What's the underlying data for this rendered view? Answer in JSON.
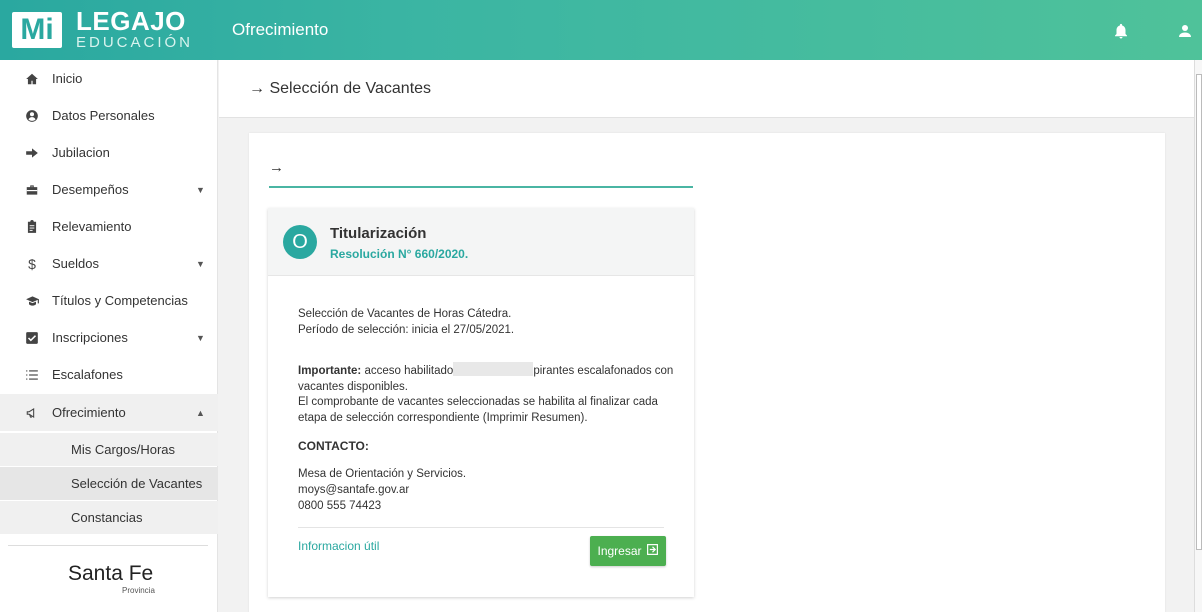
{
  "header": {
    "logo_mi": "Mi",
    "logo_legajo": "LEGAJO",
    "logo_edu": "EDUCACIÓN",
    "title": "Ofrecimiento"
  },
  "sidebar": {
    "items": [
      {
        "label": "Inicio",
        "icon": "home-icon"
      },
      {
        "label": "Datos Personales",
        "icon": "user-circle-icon"
      },
      {
        "label": "Jubilacion",
        "icon": "arrow-right-icon"
      },
      {
        "label": "Desempeños",
        "icon": "briefcase-icon"
      },
      {
        "label": "Relevamiento",
        "icon": "clipboard-icon"
      },
      {
        "label": "Sueldos",
        "icon": "dollar-icon"
      },
      {
        "label": "Títulos y Competencias",
        "icon": "graduation-cap-icon"
      },
      {
        "label": "Inscripciones",
        "icon": "checkbox-icon"
      },
      {
        "label": "Escalafones",
        "icon": "list-icon"
      },
      {
        "label": "Ofrecimiento",
        "icon": "megaphone-icon"
      }
    ],
    "sub_items": [
      "Mis Cargos/Horas",
      "Selección de Vacantes",
      "Constancias"
    ],
    "brand": "Santa Fe",
    "brand_sub": "Provincia"
  },
  "page": {
    "title": "→ Selección de Vacantes",
    "panel_arrow": "→"
  },
  "card": {
    "circle": "O",
    "title": "Titularización",
    "subtitle": "Resolución N° 660/2020.",
    "line1": "Selección de Vacantes de Horas Cátedra.",
    "line2": "Período de selección: inicia el 27/05/2021.",
    "important_label": "Importante:",
    "important_text_a": " acceso habilitado",
    "important_text_b": "pirantes escalafonados con vacantes disponibles.",
    "note": "El comprobante de vacantes seleccionadas se habilita al finalizar cada etapa de selección correspondiente (Imprimir Resumen).",
    "contact_heading": "CONTACTO:",
    "contact1": "Mesa de Orientación y Servicios.",
    "contact2": "moys@santafe.gov.ar",
    "contact3": "0800 555 74423",
    "info_link": "Informacion útil",
    "button": "Ingresar"
  },
  "colors": {
    "accent": "#2aa8a0",
    "button": "#4caf50"
  }
}
